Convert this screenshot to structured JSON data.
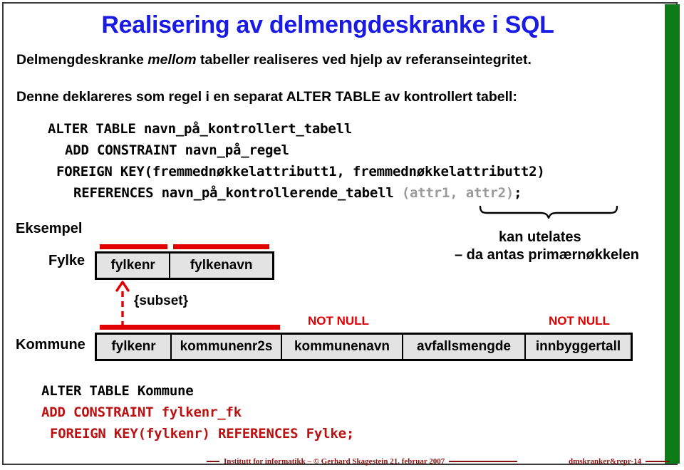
{
  "slide": {
    "title": "Realisering av delmengdeskranke i SQL",
    "accent_blue": "#1a1ae6",
    "accent_green": "#0c7a16",
    "accent_red": "#e00000",
    "accent_darkred": "#bb1111",
    "table_fill": "#e3e3e3"
  },
  "intro": {
    "line1_before": "Delmengdeskranke ",
    "line1_italic": "mellom",
    "line1_after": " tabeller realiseres ved hjelp av referanseintegritet.",
    "line2": "Denne deklareres som regel i en separat ALTER TABLE av kontrollert tabell:"
  },
  "code_top": {
    "l1": "ALTER TABLE navn_på_kontrollert_tabell",
    "l2": "ADD CONSTRAINT navn_på_regel",
    "l3": "FOREIGN KEY(fremmednøkkelattributt1, fremmednøkkelattributt2)",
    "l4_main": "REFERENCES navn_på_kontrollerende_tabell ",
    "l4_dim": "(attr1, attr2)",
    "l4_end": ";"
  },
  "labels": {
    "eksempel": "Eksempel",
    "fylke": "Fylke",
    "kommune": "Kommune",
    "subset": "{subset}"
  },
  "note": {
    "line1": "kan utelates",
    "line2": "– da antas primærnøkkelen"
  },
  "tables": {
    "fylke": {
      "name": "Fylke",
      "columns": [
        {
          "label": "fylkenr",
          "width": 105,
          "key": true
        },
        {
          "label": "fylkenavn",
          "width": 147,
          "key": true
        }
      ]
    },
    "kommune": {
      "name": "Kommune",
      "columns": [
        {
          "label": "fylkenr",
          "width": 105,
          "key": true
        },
        {
          "label": "kommunenr2s",
          "width": 155,
          "key": true
        },
        {
          "label": "kommunenavn",
          "width": 170,
          "not_null": true
        },
        {
          "label": "avfallsmengde",
          "width": 172,
          "not_null": false
        },
        {
          "label": "innbyggertall",
          "width": 153,
          "not_null": true
        }
      ]
    }
  },
  "annotations": {
    "not_null_1": "NOT NULL",
    "not_null_2": "NOT NULL"
  },
  "code_bottom": {
    "l1": "ALTER TABLE Kommune",
    "l2": "ADD CONSTRAINT fylkenr_fk",
    "l3_red": "FOREIGN KEY(fylkenr) REFERENCES Fylke",
    "l3_end": ";"
  },
  "footer": {
    "left": "Institutt for informatikk – © Gerhard Skagestein 21. februar 2007",
    "right": "dmskranker&repr-14"
  }
}
